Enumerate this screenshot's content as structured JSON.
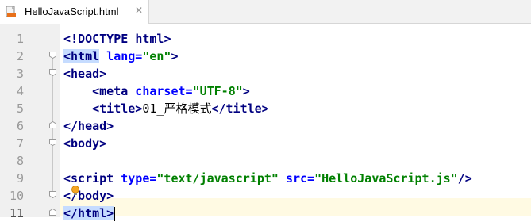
{
  "editor": {
    "tab": {
      "filename": "HelloJavaScript.html",
      "close_glyph": "✕",
      "icon": "html-file-icon"
    },
    "line_numbers": [
      "1",
      "2",
      "3",
      "4",
      "5",
      "6",
      "7",
      "8",
      "9",
      "10",
      "11"
    ],
    "current_line": "11",
    "lines": [
      {
        "parts": [
          {
            "t": "<!DOCTYPE ",
            "c": "tag"
          },
          {
            "t": "html",
            "c": "tag"
          },
          {
            "t": ">",
            "c": "tag"
          }
        ]
      },
      {
        "parts": [
          {
            "t": "<html",
            "c": "tag hl"
          },
          {
            "t": " lang=",
            "c": "attr"
          },
          {
            "t": "\"en\"",
            "c": "val"
          },
          {
            "t": ">",
            "c": "tag"
          }
        ]
      },
      {
        "parts": [
          {
            "t": "<head>",
            "c": "tag"
          }
        ]
      },
      {
        "parts": [
          {
            "t": "    <meta",
            "c": "tag"
          },
          {
            "t": " charset=",
            "c": "attr"
          },
          {
            "t": "\"UTF-8\"",
            "c": "val"
          },
          {
            "t": ">",
            "c": "tag"
          }
        ]
      },
      {
        "parts": [
          {
            "t": "    <title>",
            "c": "tag"
          },
          {
            "t": "01_",
            "c": ""
          },
          {
            "t": "严格模式",
            "c": "cjk"
          },
          {
            "t": "</title>",
            "c": "tag"
          }
        ]
      },
      {
        "parts": [
          {
            "t": "</head>",
            "c": "tag"
          }
        ]
      },
      {
        "parts": [
          {
            "t": "<body>",
            "c": "tag"
          }
        ]
      },
      {
        "parts": []
      },
      {
        "parts": [
          {
            "t": "<script",
            "c": "tag"
          },
          {
            "t": " type=",
            "c": "attr"
          },
          {
            "t": "\"text/javascript\"",
            "c": "val"
          },
          {
            "t": " src=",
            "c": "attr"
          },
          {
            "t": "\"HelloJavaScript.js\"",
            "c": "val"
          },
          {
            "t": "/>",
            "c": "tag"
          }
        ]
      },
      {
        "parts": [
          {
            "t": "<",
            "c": "tag"
          },
          {
            "t": "/body>",
            "c": "tag"
          }
        ]
      },
      {
        "parts": [
          {
            "t": "</html>",
            "c": "tag hl2"
          }
        ]
      }
    ],
    "colors": {
      "tag": "#000080",
      "attribute": "#0000ff",
      "value": "#008000",
      "gutter": "#f0f0f0",
      "current_line": "#fffae3",
      "match_highlight": "#c6dcff"
    }
  }
}
